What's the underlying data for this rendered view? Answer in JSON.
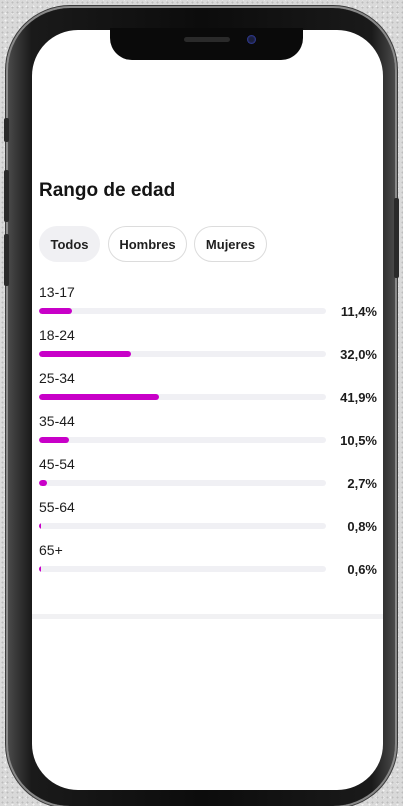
{
  "age_section": {
    "title": "Rango de edad",
    "filters": [
      {
        "label": "Todos",
        "active": true
      },
      {
        "label": "Hombres",
        "active": false
      },
      {
        "label": "Mujeres",
        "active": false
      }
    ],
    "accent_color": "#c800c8",
    "rows": [
      {
        "range": "13-17",
        "percent": "11,4%",
        "value": 11.4
      },
      {
        "range": "18-24",
        "percent": "32,0%",
        "value": 32.0
      },
      {
        "range": "25-34",
        "percent": "41,9%",
        "value": 41.9
      },
      {
        "range": "35-44",
        "percent": "10,5%",
        "value": 10.5
      },
      {
        "range": "45-54",
        "percent": "2,7%",
        "value": 2.7
      },
      {
        "range": "55-64",
        "percent": "0,8%",
        "value": 0.8
      },
      {
        "range": "65+",
        "percent": "0,6%",
        "value": 0.6
      }
    ]
  }
}
